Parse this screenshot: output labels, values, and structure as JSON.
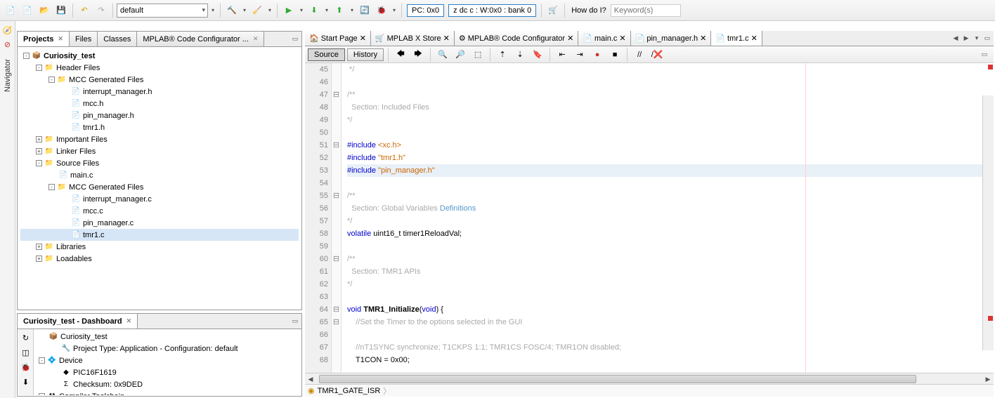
{
  "toolbar": {
    "config_combo": "default",
    "pc_label": "PC: 0x0",
    "status_label": "z dc c : W:0x0 : bank 0",
    "howdoi_label": "How do I?",
    "keywords_placeholder": "Keyword(s)"
  },
  "left_sidebar": {
    "navigator_label": "Navigator"
  },
  "project_panel": {
    "tabs": [
      "Projects",
      "Files",
      "Classes",
      "MPLAB® Code Configurator ..."
    ],
    "tree": [
      {
        "ind": 0,
        "exp": "-",
        "icon": "📦",
        "label": "Curiosity_test",
        "bold": true
      },
      {
        "ind": 1,
        "exp": "-",
        "icon": "📁",
        "label": "Header Files"
      },
      {
        "ind": 2,
        "exp": "-",
        "icon": "📁",
        "label": "MCC Generated Files"
      },
      {
        "ind": 3,
        "exp": "",
        "icon": "📄",
        "label": "interrupt_manager.h"
      },
      {
        "ind": 3,
        "exp": "",
        "icon": "📄",
        "label": "mcc.h"
      },
      {
        "ind": 3,
        "exp": "",
        "icon": "📄",
        "label": "pin_manager.h"
      },
      {
        "ind": 3,
        "exp": "",
        "icon": "📄",
        "label": "tmr1.h"
      },
      {
        "ind": 1,
        "exp": "+",
        "icon": "📁",
        "label": "Important Files"
      },
      {
        "ind": 1,
        "exp": "+",
        "icon": "📁",
        "label": "Linker Files"
      },
      {
        "ind": 1,
        "exp": "-",
        "icon": "📁",
        "label": "Source Files"
      },
      {
        "ind": 2,
        "exp": "",
        "icon": "📄",
        "label": "main.c"
      },
      {
        "ind": 2,
        "exp": "-",
        "icon": "📁",
        "label": "MCC Generated Files"
      },
      {
        "ind": 3,
        "exp": "",
        "icon": "📄",
        "label": "interrupt_manager.c"
      },
      {
        "ind": 3,
        "exp": "",
        "icon": "📄",
        "label": "mcc.c"
      },
      {
        "ind": 3,
        "exp": "",
        "icon": "📄",
        "label": "pin_manager.c"
      },
      {
        "ind": 3,
        "exp": "",
        "icon": "📄",
        "label": "tmr1.c",
        "sel": true
      },
      {
        "ind": 1,
        "exp": "+",
        "icon": "📁",
        "label": "Libraries"
      },
      {
        "ind": 1,
        "exp": "+",
        "icon": "📁",
        "label": "Loadables"
      }
    ]
  },
  "dashboard": {
    "title": "Curiosity_test - Dashboard",
    "rows": [
      {
        "ind": 0,
        "icon": "📦",
        "label": "Curiosity_test"
      },
      {
        "ind": 1,
        "icon": "🔧",
        "label": "Project Type: Application - Configuration: default"
      },
      {
        "ind": 0,
        "icon": "💠",
        "label": "Device",
        "exp": "-"
      },
      {
        "ind": 1,
        "icon": "◆",
        "label": "PIC16F1619"
      },
      {
        "ind": 1,
        "icon": "Σ",
        "label": "Checksum: 0x9DED"
      },
      {
        "ind": 0,
        "icon": "⚒",
        "label": "Compiler Toolchain",
        "exp": "-"
      }
    ]
  },
  "editor": {
    "tabs": [
      {
        "label": "Start Page",
        "icon": "🏠"
      },
      {
        "label": "MPLAB X Store",
        "icon": "🛒"
      },
      {
        "label": "MPLAB® Code Configurator",
        "icon": "⚙"
      },
      {
        "label": "main.c",
        "icon": "📄"
      },
      {
        "label": "pin_manager.h",
        "icon": "📄"
      },
      {
        "label": "tmr1.c",
        "icon": "📄",
        "active": true
      }
    ],
    "source_btn": "Source",
    "history_btn": "History",
    "breadcrumb": "TMR1_GATE_ISR",
    "code": [
      {
        "n": 45,
        "f": "",
        "html": " */",
        "c": "cm"
      },
      {
        "n": 46,
        "f": "",
        "html": ""
      },
      {
        "n": 47,
        "f": "⊟",
        "html": "/**",
        "c": "cm"
      },
      {
        "n": 48,
        "f": "",
        "html": "  Section: Included Files",
        "c": "cm"
      },
      {
        "n": 49,
        "f": "",
        "html": "*/",
        "c": "cm"
      },
      {
        "n": 50,
        "f": "",
        "html": ""
      },
      {
        "n": 51,
        "f": "⊟",
        "html": "<span class='kw'>#include</span> <span class='str'>&lt;xc.h&gt;</span>"
      },
      {
        "n": 52,
        "f": "",
        "html": "<span class='kw'>#include</span> <span class='str'>\"tmr1.h\"</span>"
      },
      {
        "n": 53,
        "f": "",
        "html": "<span class='kw'>#include</span> <span class='str'>\"pin_manager.h\"</span>",
        "hl": true
      },
      {
        "n": 54,
        "f": "",
        "html": ""
      },
      {
        "n": 55,
        "f": "⊟",
        "html": "/**",
        "c": "cm"
      },
      {
        "n": 56,
        "f": "",
        "html": "  Section: Global Variables <span class='def'>Definitions</span>",
        "c": "cm"
      },
      {
        "n": 57,
        "f": "",
        "html": "*/",
        "c": "cm"
      },
      {
        "n": 58,
        "f": "",
        "html": "<span class='kw'>volatile</span> uint16_t timer1ReloadVal;"
      },
      {
        "n": 59,
        "f": "",
        "html": ""
      },
      {
        "n": 60,
        "f": "⊟",
        "html": "/**",
        "c": "cm"
      },
      {
        "n": 61,
        "f": "",
        "html": "  Section: TMR1 APIs",
        "c": "cm"
      },
      {
        "n": 62,
        "f": "",
        "html": "*/",
        "c": "cm"
      },
      {
        "n": 63,
        "f": "",
        "html": ""
      },
      {
        "n": 64,
        "f": "⊟",
        "html": "<span class='kw'>void</span> <span class='fn'>TMR1_Initialize</span>(<span class='kw'>void</span>) {"
      },
      {
        "n": 65,
        "f": "⊟",
        "html": "    <span class='cm'>//Set the Timer to the options selected in the GUI</span>"
      },
      {
        "n": 66,
        "f": "",
        "html": ""
      },
      {
        "n": 67,
        "f": "",
        "html": "    <span class='cm'>//nT1SYNC synchronize; T1CKPS 1:1; TMR1CS FOSC/4; TMR1ON disabled;</span>"
      },
      {
        "n": 68,
        "f": "",
        "html": "    T1CON = 0x00;"
      }
    ]
  }
}
